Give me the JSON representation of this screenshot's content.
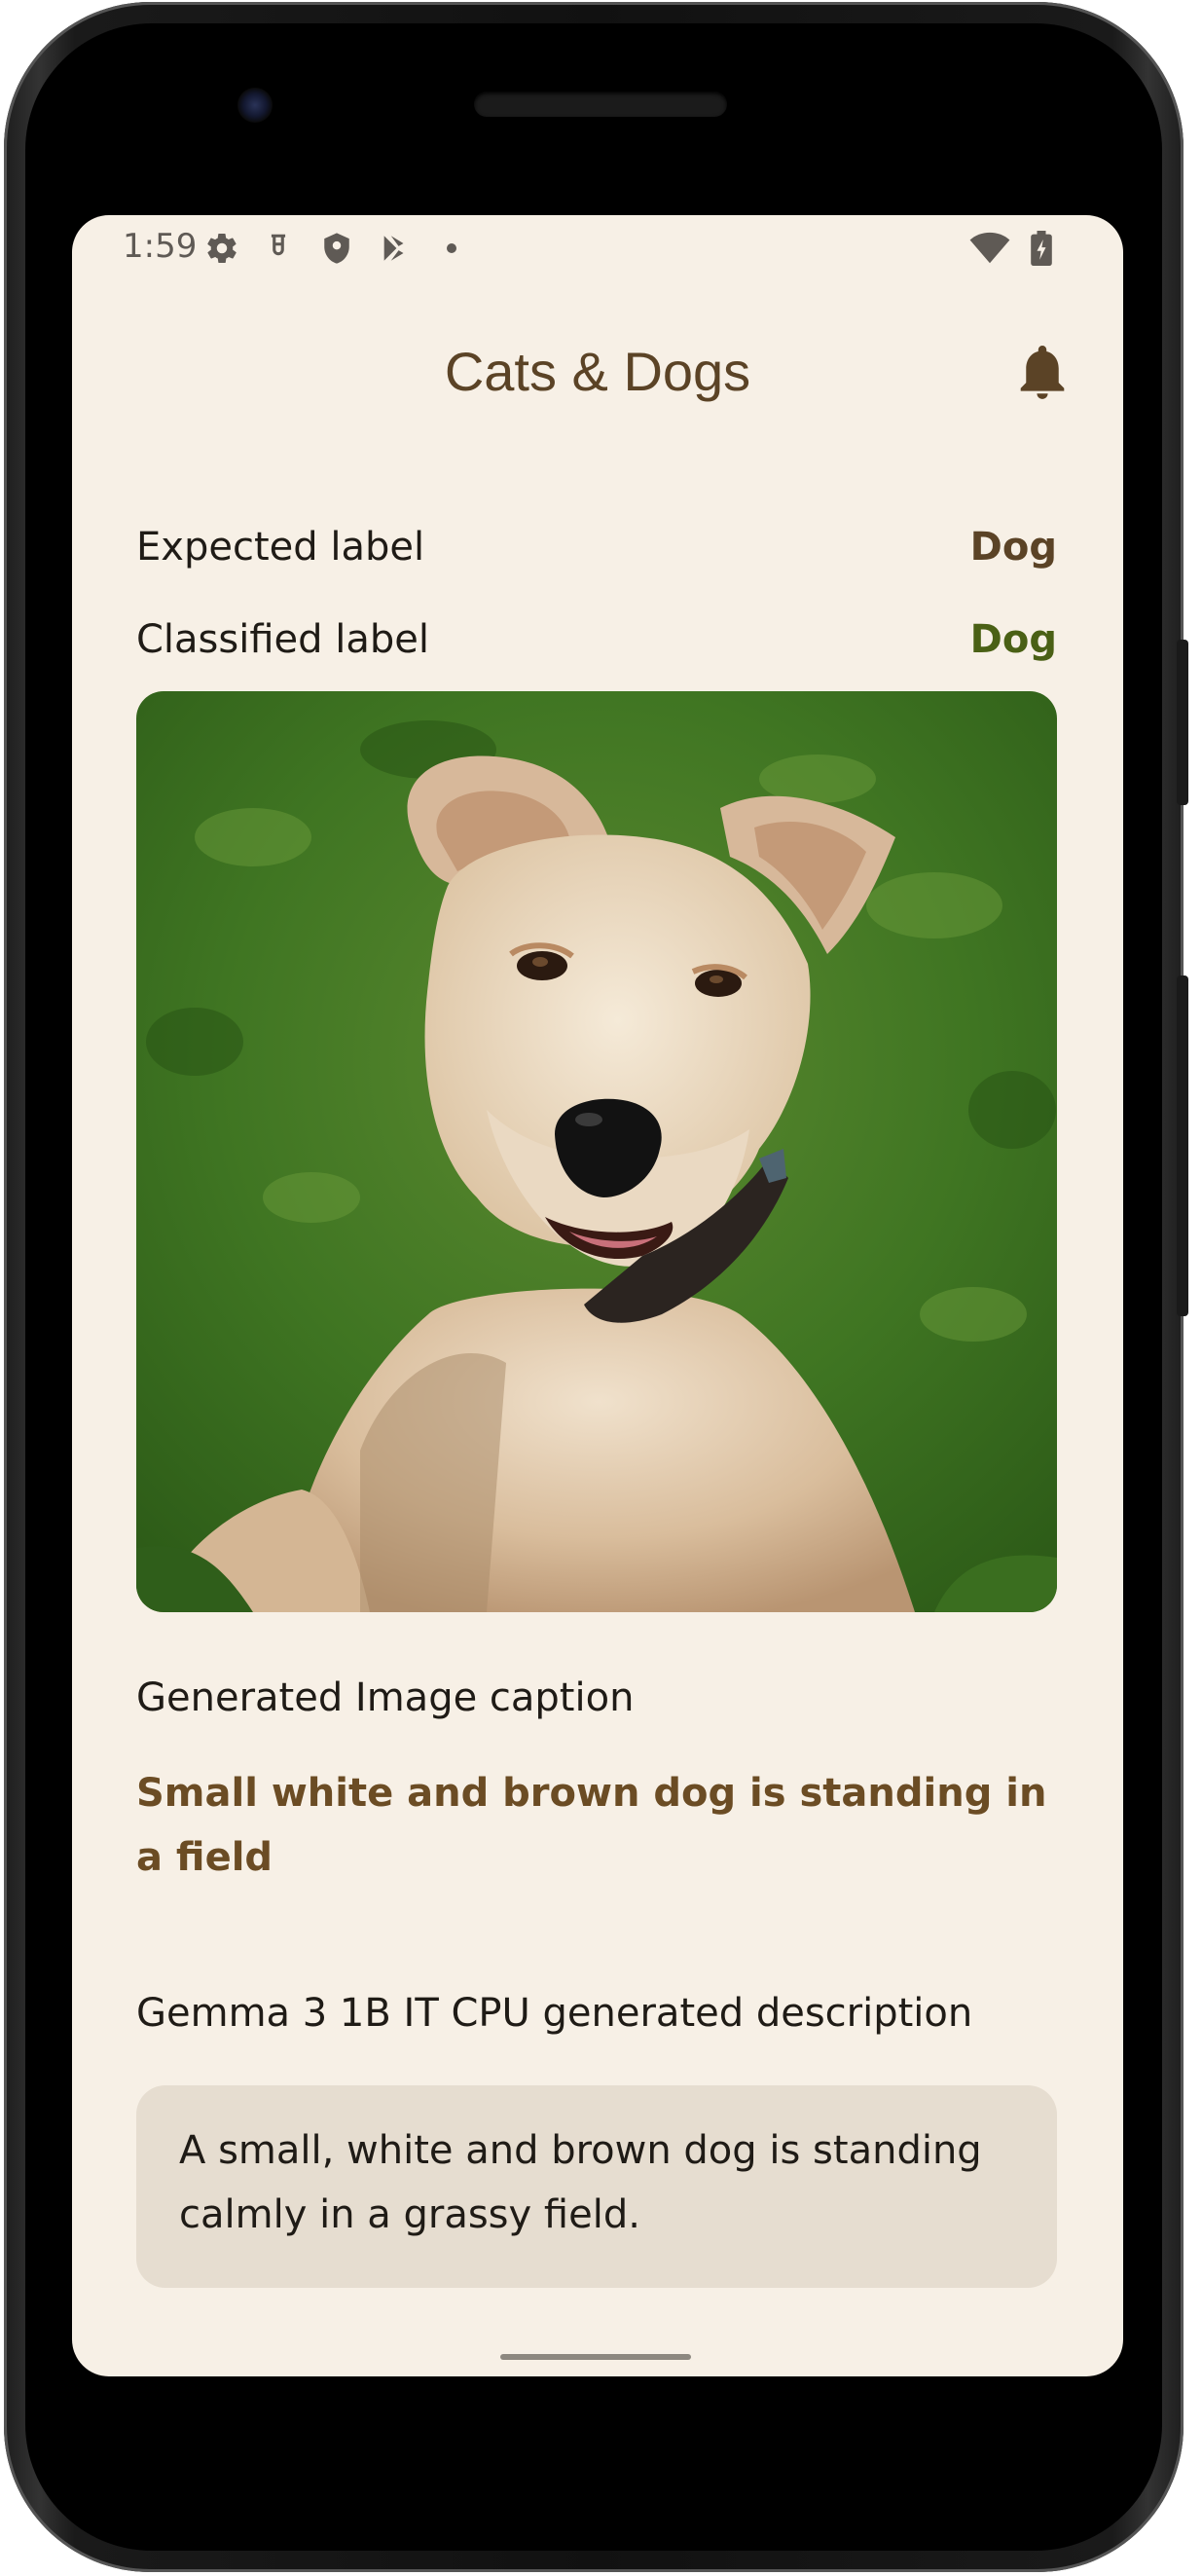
{
  "status_bar": {
    "time": "1:59",
    "left_icons": [
      "settings-icon",
      "test-tube-icon",
      "shield-icon",
      "play-store-icon",
      "dot-icon"
    ],
    "right_icons": [
      "wifi-icon",
      "battery-charging-icon"
    ]
  },
  "app_bar": {
    "title": "Cats & Dogs",
    "action_icon": "notifications-bell-icon"
  },
  "labels": {
    "expected_label": "Expected label",
    "expected_value": "Dog",
    "classified_label": "Classified label",
    "classified_value": "Dog"
  },
  "image": {
    "subject": "dog-photo"
  },
  "caption": {
    "label": "Generated Image caption",
    "text": "Small white and brown dog is standing in a field"
  },
  "description": {
    "label": "Gemma 3 1B IT CPU generated description",
    "text": "A small, white and brown dog is standing calmly in a grassy field."
  },
  "colors": {
    "background": "#f7f0e6",
    "title": "#5b4326",
    "expected_value": "#5b4326",
    "classified_value": "#4a6015",
    "caption": "#6b4c24",
    "description_box": "#e6ddd0"
  }
}
